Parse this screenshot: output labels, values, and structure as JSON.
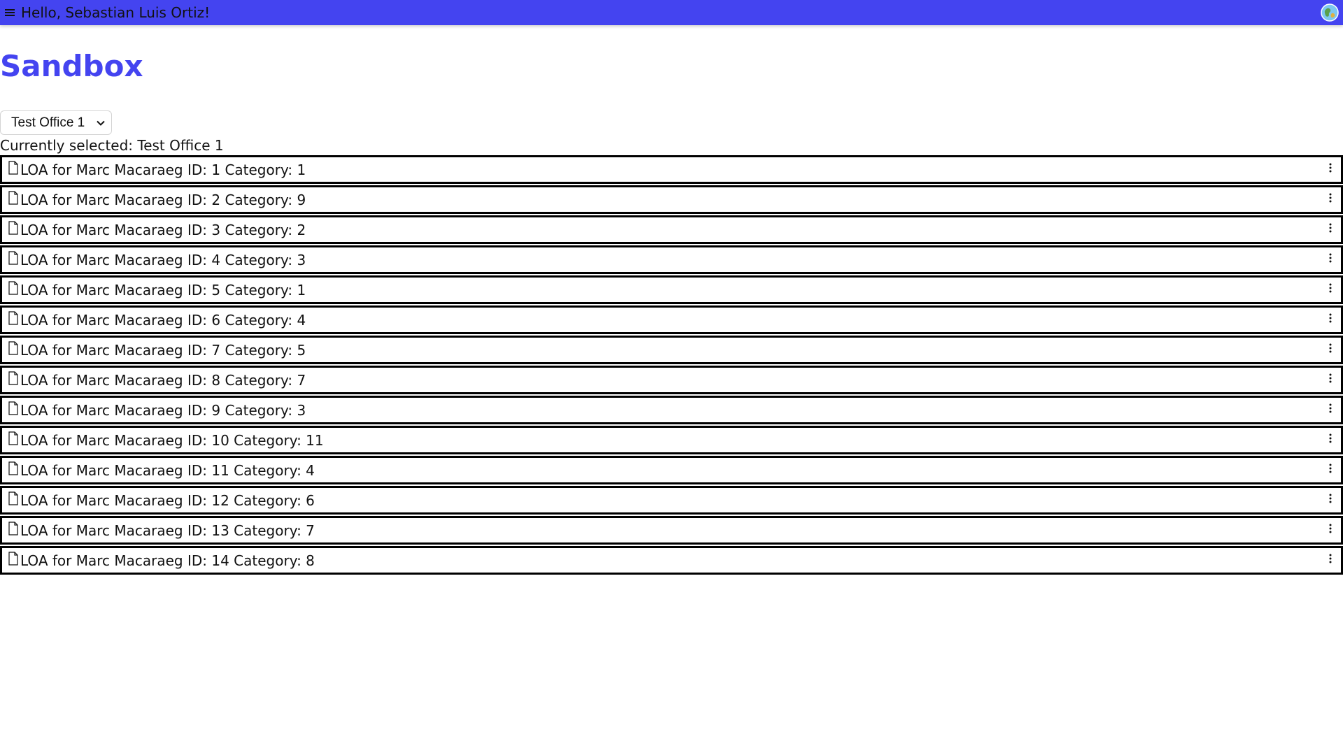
{
  "header": {
    "greeting": "Hello, Sebastian Luis Ortiz!",
    "menu_icon": "hamburger-menu-icon",
    "avatar_icon": "globe-icon",
    "brand_color": "#4444f0"
  },
  "page": {
    "title": "Sandbox"
  },
  "office_select": {
    "selected": "Test Office 1"
  },
  "current_selection": "Currently selected: Test Office 1",
  "documents": [
    {
      "label": "LOA for Marc Macaraeg ID: 1 Category: 1"
    },
    {
      "label": "LOA for Marc Macaraeg ID: 2 Category: 9"
    },
    {
      "label": "LOA for Marc Macaraeg ID: 3 Category: 2"
    },
    {
      "label": "LOA for Marc Macaraeg ID: 4 Category: 3"
    },
    {
      "label": "LOA for Marc Macaraeg ID: 5 Category: 1"
    },
    {
      "label": "LOA for Marc Macaraeg ID: 6 Category: 4"
    },
    {
      "label": "LOA for Marc Macaraeg ID: 7 Category: 5"
    },
    {
      "label": "LOA for Marc Macaraeg ID: 8 Category: 7"
    },
    {
      "label": "LOA for Marc Macaraeg ID: 9 Category: 3"
    },
    {
      "label": "LOA for Marc Macaraeg ID: 10 Category: 11"
    },
    {
      "label": "LOA for Marc Macaraeg ID: 11 Category: 4"
    },
    {
      "label": "LOA for Marc Macaraeg ID: 12 Category: 6"
    },
    {
      "label": "LOA for Marc Macaraeg ID: 13 Category: 7"
    },
    {
      "label": "LOA for Marc Macaraeg ID: 14 Category: 8"
    }
  ]
}
